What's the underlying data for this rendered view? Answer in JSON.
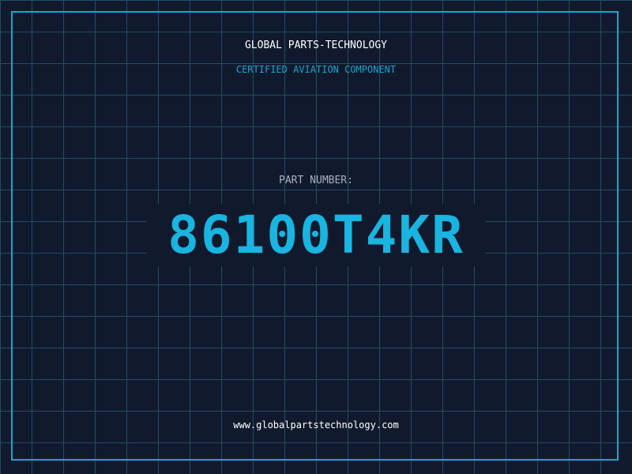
{
  "header": {
    "brand": "GLOBAL PARTS-TECHNOLOGY",
    "subtitle": "CERTIFIED AVIATION COMPONENT"
  },
  "part": {
    "label": "PART NUMBER:",
    "number": "86100T4KR"
  },
  "footer": {
    "website": "www.globalpartstechnology.com"
  },
  "colors": {
    "background": "#111a2d",
    "grid": "#1f4d66",
    "accent": "#1ba5cf",
    "part_number": "#19b4e0",
    "text": "#ffffff",
    "muted": "#a7b0c0"
  }
}
